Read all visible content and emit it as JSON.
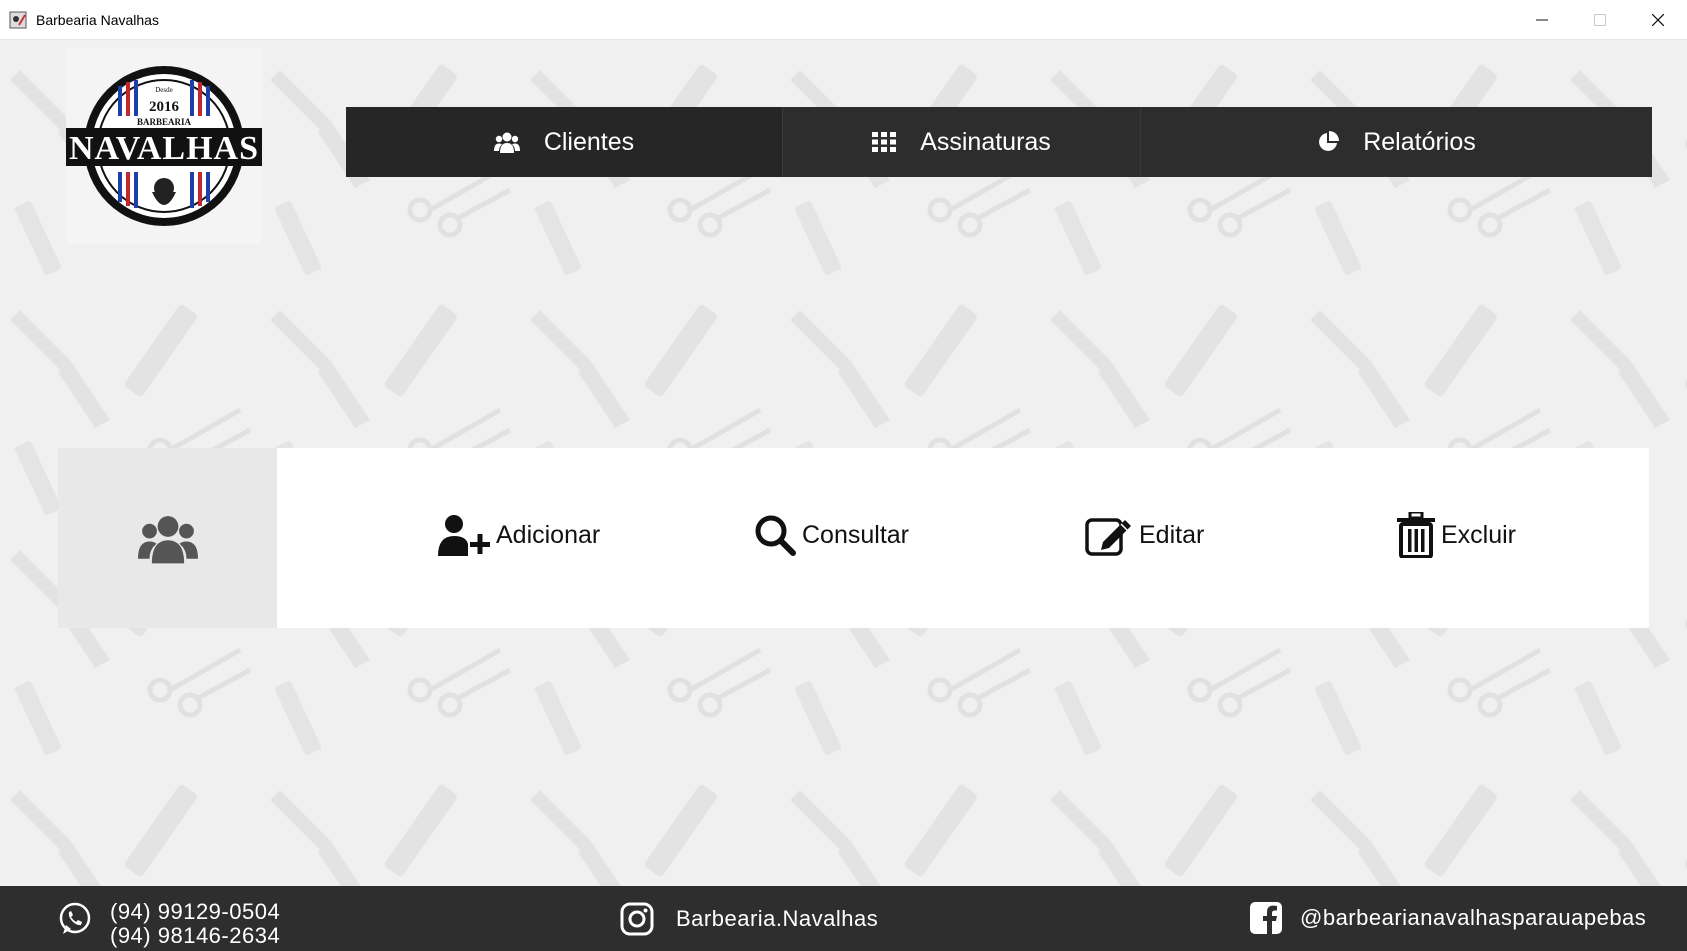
{
  "window": {
    "title": "Barbearia Navalhas",
    "minimize_glyph": "—",
    "maximize_glyph": "☐",
    "close_glyph": "✕"
  },
  "logo": {
    "text_top": "Desde",
    "year": "2016",
    "barbearia": "BARBEARIA",
    "name": "NAVALHAS"
  },
  "nav": {
    "items": [
      {
        "label": "Clientes",
        "icon": "users-icon"
      },
      {
        "label": "Assinaturas",
        "icon": "grid-icon"
      },
      {
        "label": "Relatórios",
        "icon": "pie-chart-icon"
      }
    ]
  },
  "actions": {
    "section_icon": "users-icon",
    "items": [
      {
        "label": "Adicionar",
        "icon": "user-plus-icon"
      },
      {
        "label": "Consultar",
        "icon": "search-icon"
      },
      {
        "label": "Editar",
        "icon": "edit-icon"
      },
      {
        "label": "Excluir",
        "icon": "trash-icon"
      }
    ]
  },
  "footer": {
    "phone1": "(94) 99129-0504",
    "phone2": "(94) 98146-2634",
    "instagram": "Barbearia.Navalhas",
    "facebook": "@barbearianavalhasparauapebas"
  },
  "colors": {
    "nav_bg": "#262626",
    "footer_bg": "#2e2e2e",
    "background": "#f0f0f0",
    "panel_left": "#e8e8e8"
  }
}
